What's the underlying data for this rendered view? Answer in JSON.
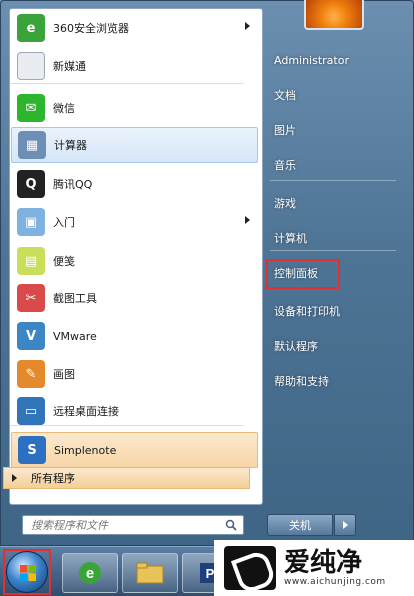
{
  "left_items": [
    {
      "label": "360安全浏览器",
      "icon": "360-browser-icon",
      "color": "#3aa33a",
      "glyph": "e",
      "submenu": true,
      "hl": ""
    },
    {
      "label": "新媒通",
      "icon": "document-icon",
      "color": "#e9edf2",
      "glyph": "",
      "submenu": false,
      "hl": ""
    },
    {
      "label": "微信",
      "icon": "wechat-icon",
      "color": "#2db52d",
      "glyph": "✉",
      "submenu": false,
      "hl": ""
    },
    {
      "label": "计算器",
      "icon": "calculator-icon",
      "color": "#6d8fb5",
      "glyph": "▦",
      "submenu": false,
      "hl": "blue"
    },
    {
      "label": "腾讯QQ",
      "icon": "qq-penguin-icon",
      "color": "#222222",
      "glyph": "Q",
      "submenu": false,
      "hl": ""
    },
    {
      "label": "入门",
      "icon": "getting-started-icon",
      "color": "#7fb2e0",
      "glyph": "▣",
      "submenu": true,
      "hl": ""
    },
    {
      "label": "便笺",
      "icon": "sticky-notes-icon",
      "color": "#c9df5a",
      "glyph": "▤",
      "submenu": false,
      "hl": ""
    },
    {
      "label": "截图工具",
      "icon": "snipping-tool-icon",
      "color": "#d94b4b",
      "glyph": "✂",
      "submenu": false,
      "hl": ""
    },
    {
      "label": "VMware",
      "icon": "vmware-icon",
      "color": "#3c86c6",
      "glyph": "V",
      "submenu": false,
      "hl": ""
    },
    {
      "label": "画图",
      "icon": "paint-icon",
      "color": "#e48a2b",
      "glyph": "✎",
      "submenu": false,
      "hl": ""
    },
    {
      "label": "远程桌面连接",
      "icon": "remote-desktop-icon",
      "color": "#3275b8",
      "glyph": "▭",
      "submenu": false,
      "hl": ""
    },
    {
      "label": "Simplenote",
      "icon": "simplenote-icon",
      "color": "#2d6fc0",
      "glyph": "S",
      "submenu": false,
      "hl": "orange"
    }
  ],
  "all_programs": "所有程序",
  "search_placeholder": "搜索程序和文件",
  "right_items": [
    {
      "label": "Administrator",
      "name": "right-item-administrator"
    },
    {
      "label": "文档",
      "name": "right-item-documents"
    },
    {
      "label": "图片",
      "name": "right-item-pictures"
    },
    {
      "label": "音乐",
      "name": "right-item-music"
    },
    {
      "label": "游戏",
      "name": "right-item-games"
    },
    {
      "label": "计算机",
      "name": "right-item-computer"
    },
    {
      "label": "控制面板",
      "name": "right-item-control-panel"
    },
    {
      "label": "设备和打印机",
      "name": "right-item-devices-printers"
    },
    {
      "label": "默认程序",
      "name": "right-item-default-programs"
    },
    {
      "label": "帮助和支持",
      "name": "right-item-help-support"
    }
  ],
  "shutdown_label": "关机",
  "watermark": {
    "text": "爱纯净",
    "url": "www.aichunjing.com"
  },
  "colors": {
    "highlight_box": "#e23030",
    "taskbar": "#3a5878"
  }
}
